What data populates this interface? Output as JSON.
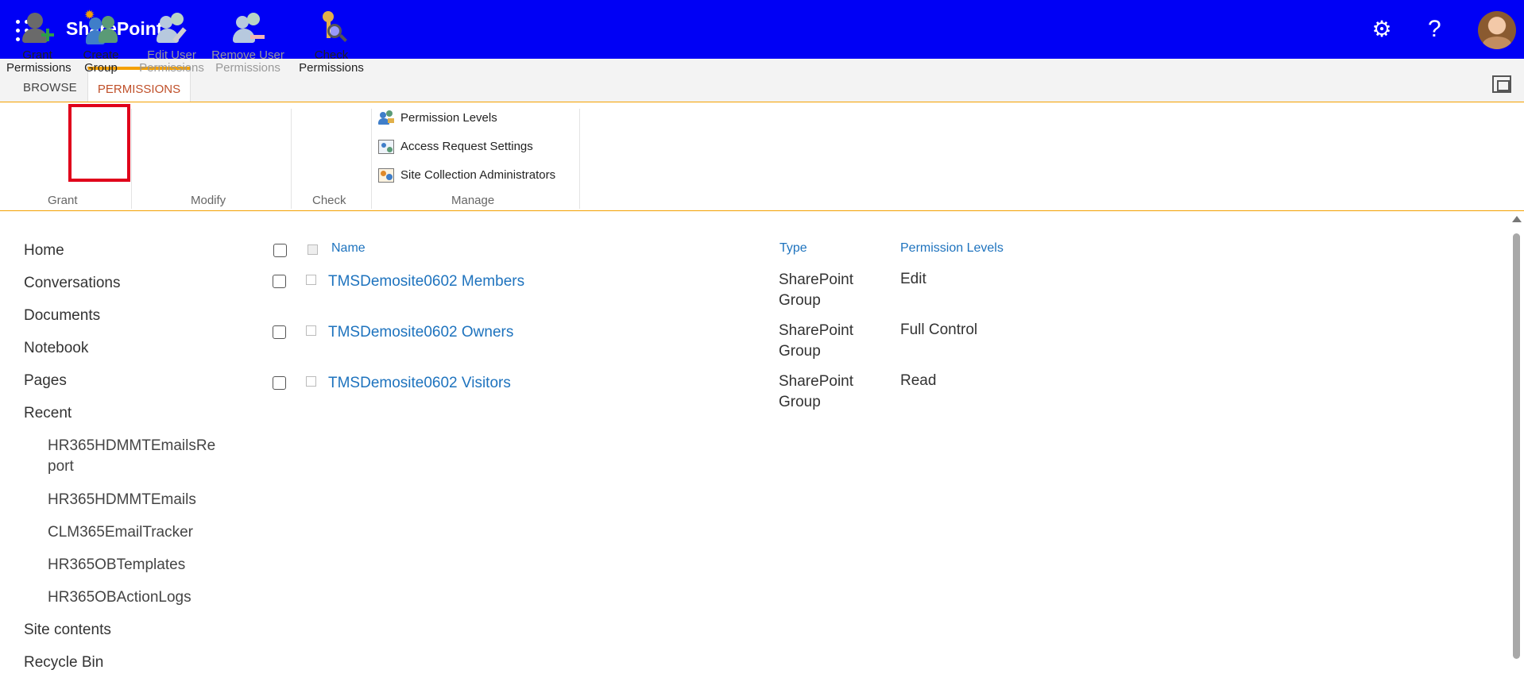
{
  "suite": {
    "app_title": "SharePoint",
    "help_glyph": "?"
  },
  "tabs": {
    "browse": "BROWSE",
    "permissions": "PERMISSIONS"
  },
  "ribbon": {
    "grant_permissions": [
      "Grant",
      "Permissions"
    ],
    "create_group": [
      "Create",
      "Group"
    ],
    "edit_user_permissions": [
      "Edit User",
      "Permissions"
    ],
    "remove_user_permissions": [
      "Remove User",
      "Permissions"
    ],
    "check_permissions": [
      "Check",
      "Permissions"
    ],
    "manage": [
      "Permission Levels",
      "Access Request Settings",
      "Site Collection Administrators"
    ],
    "groups": {
      "grant": "Grant",
      "modify": "Modify",
      "check": "Check",
      "manage": "Manage"
    }
  },
  "nav": {
    "items": [
      "Home",
      "Conversations",
      "Documents",
      "Notebook",
      "Pages",
      "Recent"
    ],
    "recent": [
      "HR365HDMMTEmailsRe port",
      "HR365HDMMTEmails",
      "CLM365EmailTracker",
      "HR365OBTemplates",
      "HR365OBActionLogs"
    ],
    "bottom": [
      "Site contents",
      "Recycle Bin"
    ]
  },
  "table": {
    "headers": {
      "name": "Name",
      "type": "Type",
      "permission_levels": "Permission Levels"
    },
    "rows": [
      {
        "name": "TMSDemosite0602 Members",
        "type": "SharePoint Group",
        "permission": "Edit"
      },
      {
        "name": "TMSDemosite0602 Owners",
        "type": "SharePoint Group",
        "permission": "Full Control"
      },
      {
        "name": "TMSDemosite0602 Visitors",
        "type": "SharePoint Group",
        "permission": "Read"
      }
    ]
  },
  "colors": {
    "suite_bar": "#0000f5",
    "accent": "#f4a000",
    "link": "#1e73be",
    "highlight_border": "#e0001b"
  }
}
